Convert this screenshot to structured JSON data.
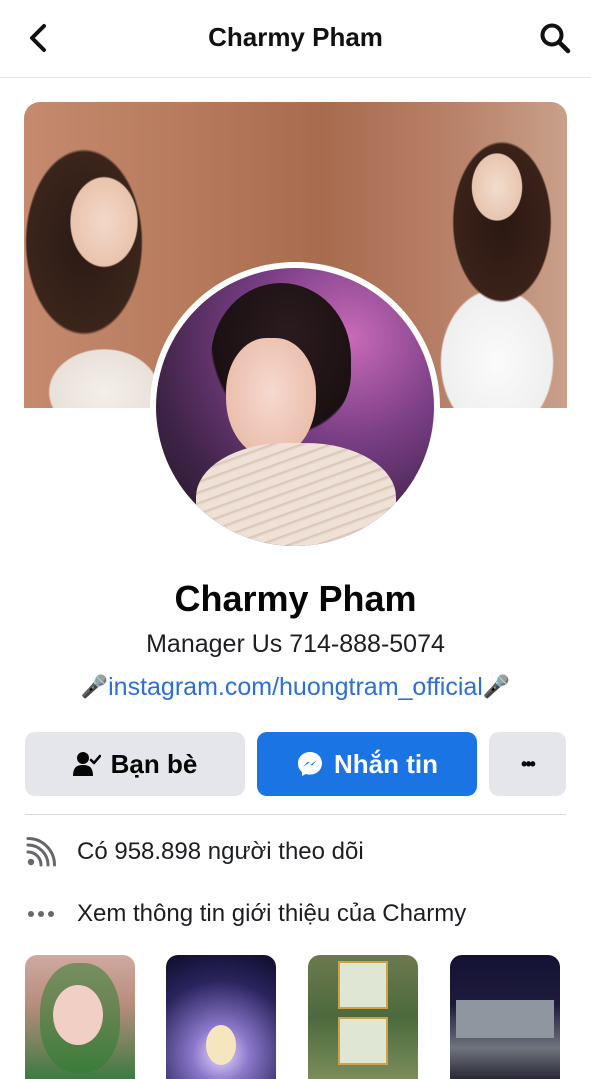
{
  "header": {
    "title": "Charmy Pham",
    "back_icon": "chevron-left-icon",
    "search_icon": "search-icon"
  },
  "profile": {
    "name": "Charmy Pham",
    "bio": "Manager Us 714-888-5074",
    "link_prefix_emoji": "🎤",
    "link": "instagram.com/huongtram_official",
    "link_suffix_emoji": "🎤"
  },
  "actions": {
    "friends_label": "Bạn bè",
    "message_label": "Nhắn tin",
    "more_label": "•••"
  },
  "info": {
    "followers": "Có 958.898 người theo dõi",
    "about": "Xem thông tin giới thiệu của Charmy"
  },
  "colors": {
    "accent": "#1b74e4",
    "link": "#2d6fd6",
    "button_gray": "#e4e6eb"
  }
}
